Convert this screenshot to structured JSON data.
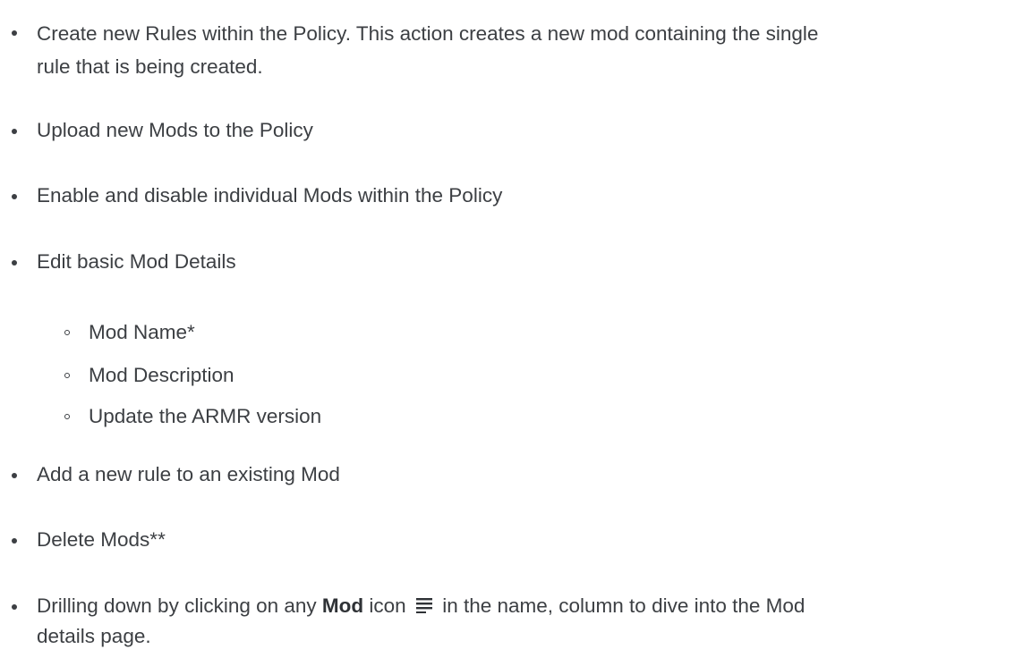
{
  "list": {
    "item1_line1": "Create new Rules within the Policy. This action creates a new mod containing the single",
    "item1_line2": "rule that is being created.",
    "item2": "Upload new Mods to the Policy",
    "item3": "Enable and disable individual Mods within the Policy",
    "item4": "Edit basic Mod Details",
    "sub1": "Mod Name*",
    "sub2": "Mod Description",
    "sub3": "Update the ARMR version",
    "item5": "Add a new rule to an existing Mod",
    "item6": "Delete Mods**",
    "item7_prefix": "Drilling down by clicking on any ",
    "item7_bold": "Mod",
    "item7_mid": " icon",
    "item7_suffix": " in the name, column to dive into the Mod",
    "item7_line2": "details page.",
    "mod_icon": "lines-icon"
  }
}
